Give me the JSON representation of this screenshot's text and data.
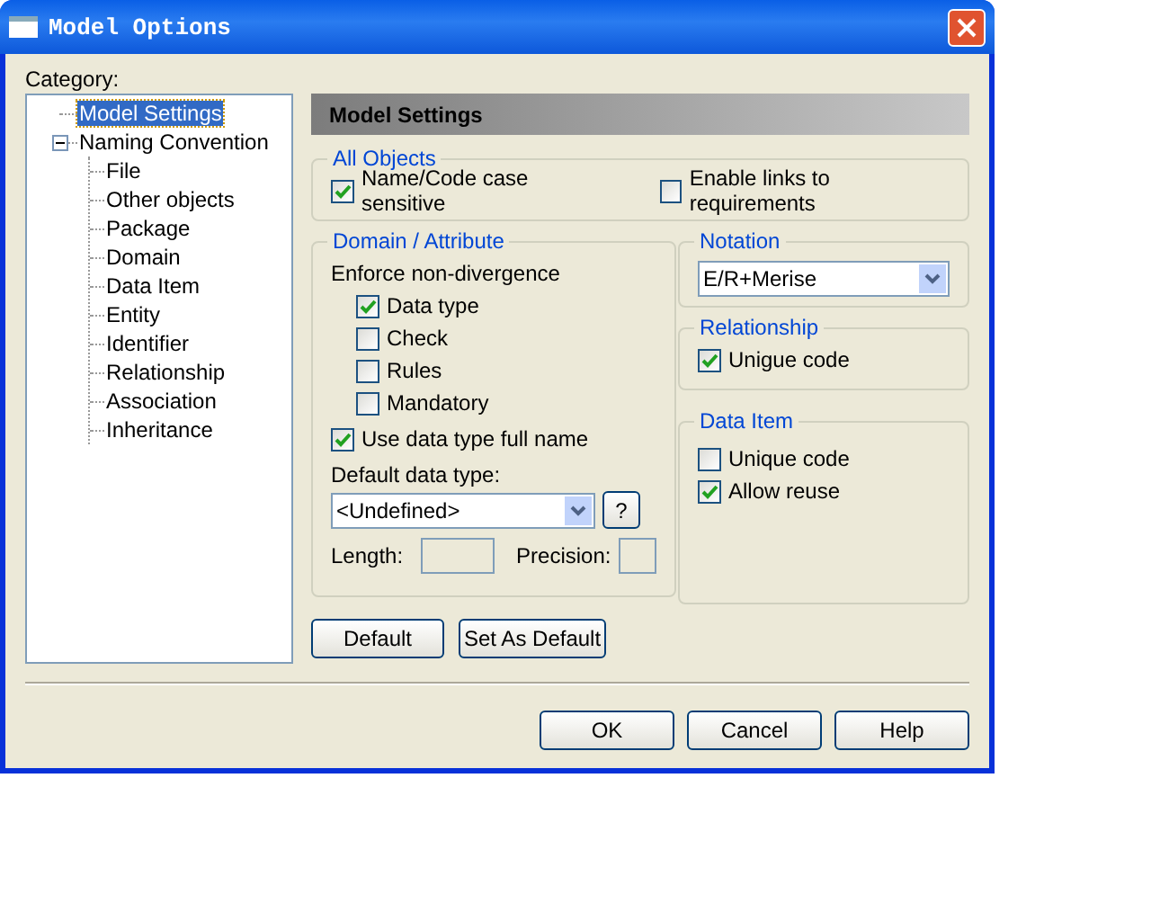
{
  "window": {
    "title": "Model Options"
  },
  "category_label": "Category:",
  "tree": [
    {
      "label": "Model Settings",
      "selected": true
    },
    {
      "label": "Naming Convention",
      "selected": false,
      "expanded": true,
      "children": [
        {
          "label": "File",
          "selected": false
        },
        {
          "label": "Other objects",
          "selected": false
        },
        {
          "label": "Package",
          "selected": false
        },
        {
          "label": "Domain",
          "selected": false
        },
        {
          "label": "Data Item",
          "selected": false
        },
        {
          "label": "Entity",
          "selected": false
        },
        {
          "label": "Identifier",
          "selected": false
        },
        {
          "label": "Relationship",
          "selected": false
        },
        {
          "label": "Association",
          "selected": false
        },
        {
          "label": "Inheritance",
          "selected": false
        }
      ]
    }
  ],
  "panel": {
    "title": "Model Settings"
  },
  "all_objects": {
    "title": "All Objects",
    "options": [
      {
        "label": "Name/Code case sensitive",
        "checked": true
      },
      {
        "label": "Enable links to requirements",
        "checked": false
      }
    ]
  },
  "domain_attribute": {
    "title": "Domain / Attribute",
    "enforce_label": "Enforce non-divergence",
    "enforce_options": [
      {
        "label": "Data type",
        "checked": true
      },
      {
        "label": "Check",
        "checked": false
      },
      {
        "label": "Rules",
        "checked": false
      },
      {
        "label": "Mandatory",
        "checked": false
      }
    ],
    "full_name": {
      "label": "Use data type full name",
      "checked": true
    },
    "default_type_label": "Default data type:",
    "default_type": {
      "value": "<Undefined>"
    },
    "help_button": "?",
    "length_label": "Length:",
    "precision_label": "Precision:"
  },
  "notation": {
    "title": "Notation",
    "value": "E/R+Merise"
  },
  "relationship": {
    "title": "Relationship",
    "options": [
      {
        "label": "Unigue code",
        "checked": true
      }
    ]
  },
  "data_item": {
    "title": "Data Item",
    "options": [
      {
        "label": "Unique code",
        "checked": false
      },
      {
        "label": "Allow reuse",
        "checked": true
      }
    ]
  },
  "panel_buttons": [
    "Default",
    "Set As Default"
  ],
  "buttons": [
    "OK",
    "Cancel",
    "Help"
  ]
}
